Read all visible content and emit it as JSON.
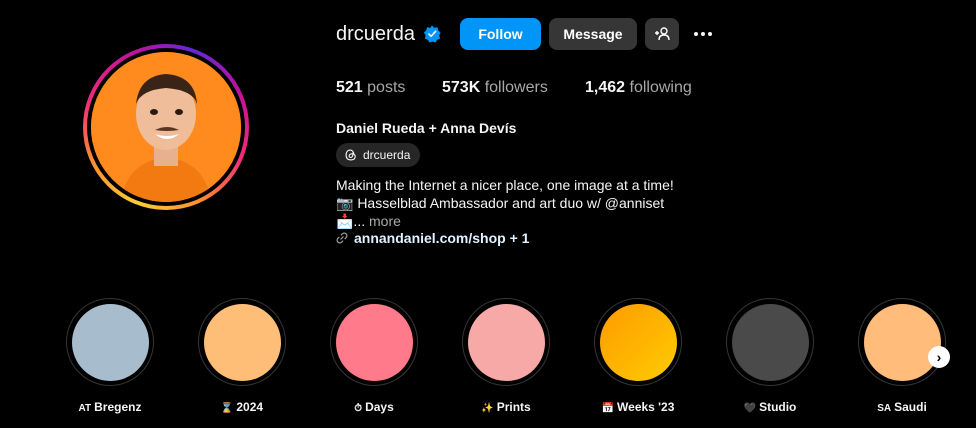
{
  "profile": {
    "username": "drcuerda",
    "full_name": "Daniel Rueda + Anna Devís",
    "threads_handle": "drcuerda",
    "bio_line1": "Making the Internet a nicer place, one image at a time!",
    "bio_line2": "📷 Hasselblad Ambassador and art duo w/ @anniset",
    "bio_line3_prefix": "📩...",
    "bio_more": "more",
    "link_text": "annandaniel.com/shop + 1"
  },
  "buttons": {
    "follow": "Follow",
    "message": "Message",
    "add_user_icon": "add-user-icon",
    "more_icon": "more-options-icon"
  },
  "stats": {
    "posts_value": "521",
    "posts_label": "posts",
    "followers_value": "573K",
    "followers_label": "followers",
    "following_value": "1,462",
    "following_label": "following"
  },
  "highlights": [
    {
      "emoji": "AT",
      "label": "Bregenz",
      "color": "#a7bccd"
    },
    {
      "emoji": "⌛",
      "label": "2024",
      "color": "#ffbe78"
    },
    {
      "emoji": "⏱",
      "label": "Days",
      "color": "#ff7a8a"
    },
    {
      "emoji": "✨",
      "label": "Prints",
      "color": "#f7a9a8"
    },
    {
      "emoji": "📅",
      "label": "Weeks '23",
      "color": "#ffb300"
    },
    {
      "emoji": "🖤",
      "label": "Studio",
      "color": "#4a4a4a"
    },
    {
      "emoji": "SA",
      "label": "Saudi",
      "color": "#ffbc7a"
    }
  ],
  "colors": {
    "accent": "#0095f6",
    "verified": "#0095f6",
    "secondary_button": "#363636"
  }
}
